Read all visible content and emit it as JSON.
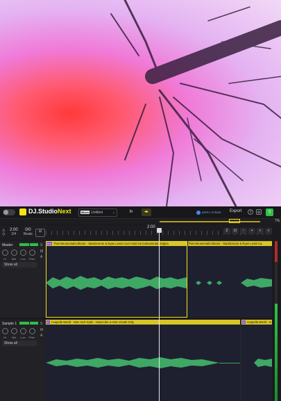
{
  "app": {
    "brand_dj": "DJ.Studio",
    "brand_next": "Next",
    "project_badge": "Mixes",
    "project_name": "Untitled",
    "stems_label": "APPLY STEMS",
    "export_label": "Export",
    "zoom_percent": "7%"
  },
  "transport": {
    "time": "2:00",
    "time_sub": "2/4",
    "beats": "0/0",
    "beats_sub": "Beats"
  },
  "ruler": {
    "position_label": "2:00"
  },
  "tracks": [
    {
      "name": "Master",
      "knobs": [
        "Hi",
        "Mid",
        "Low",
        "Filter"
      ],
      "show_label": "Show all",
      "clips": [
        {
          "tag": "Em",
          "title": "TheInstrumentalCollector - Macklemore & Ryan Lewis Can't Hold Us Instrumental Origina"
        },
        {
          "tag": "",
          "title": "TheInstrumentalCollector - Macklemore & Ryan Lewis Ca"
        }
      ]
    },
    {
      "name": "Sample 1",
      "knobs": [
        "Hi",
        "Mid",
        "Low",
        "Filter"
      ],
      "show_label": "Show all",
      "clips": [
        {
          "tag": "C",
          "title": "Acapella World - Nine Inch Nails - Head Like a Hole Vocals Only"
        },
        {
          "tag": "C",
          "title": "Acapella World - N"
        }
      ]
    }
  ],
  "colors": {
    "accent_yellow": "#f3e21a",
    "wave_green": "#3fa864",
    "playhead": "#e8e8e8"
  }
}
